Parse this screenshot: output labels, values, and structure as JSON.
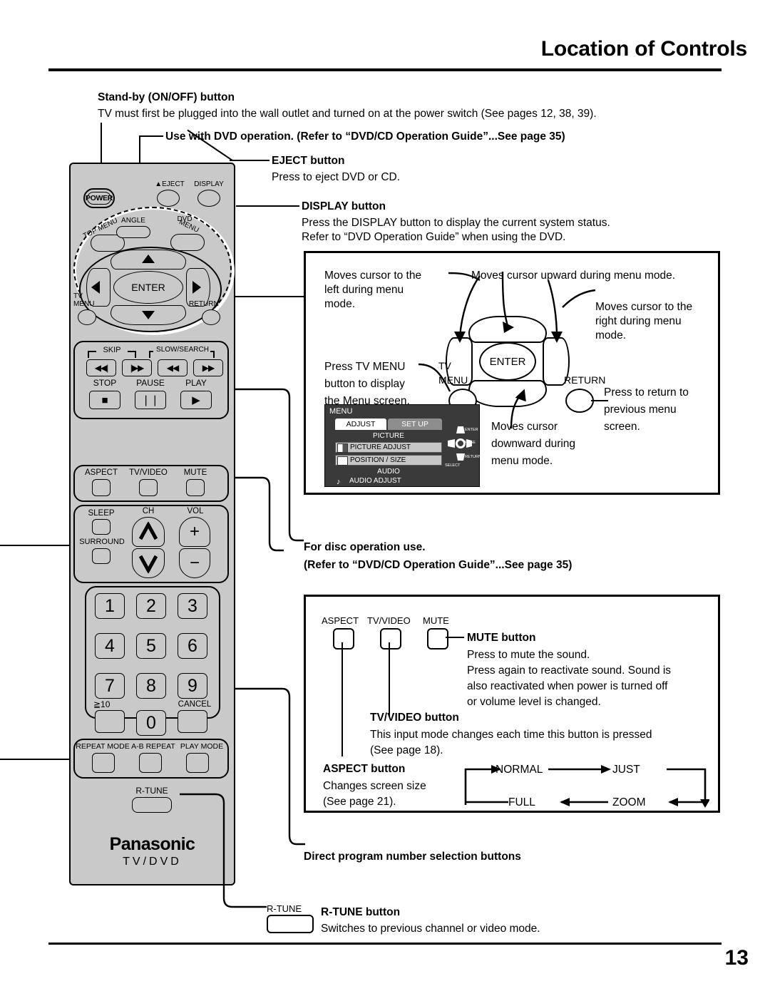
{
  "header": {
    "title": "Location of Controls"
  },
  "footer": {
    "page_number": "13"
  },
  "callouts": {
    "standby_title": "Stand-by (ON/OFF) button",
    "standby_text": "TV must first be plugged into the wall outlet and turned on at the power switch (See pages 12, 38, 39).",
    "dvd_use": "Use with DVD operation. (Refer to “DVD/CD Operation Guide”...See page 35)",
    "eject_title": "EJECT button",
    "eject_text": "Press to eject DVD or CD.",
    "display_title": "DISPLAY button",
    "display_text1": "Press the DISPLAY button to display the current system status.",
    "display_text2": "Refer to “DVD Operation Guide” when using the DVD.",
    "disc_title": "For disc operation use.",
    "disc_sub": "(Refer to “DVD/CD Operation Guide”...See page 35)",
    "direct_program": "Direct program number selection buttons",
    "rtune_title": "R-TUNE button",
    "rtune_text": "Switches to previous channel or video mode.",
    "rtune_key_label": "R-TUNE"
  },
  "cursor_panel": {
    "left": "Moves cursor to the\nleft during menu\nmode.",
    "left_l1": "Moves cursor to the",
    "left_l2": "left during menu",
    "left_l3": "mode.",
    "up": "Moves cursor upward during menu mode.",
    "right_l1": "Moves cursor to the",
    "right_l2": "right during menu",
    "right_l3": "mode.",
    "down_l1": "Moves cursor",
    "down_l2": "downward during",
    "down_l3": "menu mode.",
    "tvmenu_l1": "Press TV MENU",
    "tvmenu_l2": "button to display",
    "tvmenu_l3": "the Menu screen.",
    "return_l1": "Press to return to",
    "return_l2": "previous menu",
    "return_l3": "screen.",
    "enter_label": "ENTER",
    "tvmenu_label_1": "TV",
    "tvmenu_label_2": "MENU",
    "return_label": "RETURN"
  },
  "menu_screen": {
    "title": "MENU",
    "tab_active": "ADJUST",
    "tab_inactive": "SET UP",
    "section_picture": "PICTURE",
    "row_picture_adjust": "PICTURE  ADJUST",
    "row_position_size": "POSITION / SIZE",
    "section_audio": "AUDIO",
    "row_audio_adjust": "AUDIO  ADJUST",
    "nav_enter": "ENTER",
    "nav_page": "PAGE",
    "nav_return": "RETURN",
    "nav_select": "SELECT"
  },
  "bottom_panel": {
    "label_aspect": "ASPECT",
    "label_tvvideo": "TV/VIDEO",
    "label_mute": "MUTE",
    "mute_title": "MUTE button",
    "mute_l1": "Press to mute the sound.",
    "mute_l2": "Press again to reactivate sound. Sound is",
    "mute_l3": "also reactivated when power is turned off",
    "mute_l4": "or volume level is changed.",
    "tvvideo_title": "TV/VIDEO button",
    "tvvideo_l1": "This input mode changes each time this button is pressed",
    "tvvideo_l2": "(See page 18).",
    "aspect_title": "ASPECT button",
    "aspect_l1": "Changes screen size",
    "aspect_l2": "(See page 21).",
    "cycle": [
      "NORMAL",
      "JUST",
      "ZOOM",
      "FULL"
    ]
  },
  "remote": {
    "power": "POWER",
    "eject": "EJECT",
    "eject_arrow": "▲",
    "display": "DISPLAY",
    "top_menu": "TOP MENU",
    "angle": "ANGLE",
    "dvd": "DVD",
    "dvd_menu": "MENU",
    "tv": "TV",
    "menu": "MENU",
    "return": "RETURN",
    "enter": "ENTER",
    "skip": "SKIP",
    "slow_search": "SLOW/SEARCH",
    "skip_back": "◀◀|",
    "skip_fwd": "|▶▶",
    "search_back": "◀◀",
    "search_fwd": "▶▶",
    "stop": "STOP",
    "pause": "PAUSE",
    "play": "PLAY",
    "stop_glyph": "■",
    "pause_glyph": "❘❘",
    "play_glyph": "▶",
    "aspect": "ASPECT",
    "tvvideo": "TV/VIDEO",
    "mute": "MUTE",
    "sleep": "SLEEP",
    "surround": "SURROUND",
    "ch": "CH",
    "vol": "VOL",
    "vol_plus": "+",
    "vol_minus": "−",
    "numbers": [
      "1",
      "2",
      "3",
      "4",
      "5",
      "6",
      "7",
      "8",
      "9"
    ],
    "zero": "0",
    "ge10": "≧10",
    "cancel": "CANCEL",
    "repeat_mode": "REPEAT MODE",
    "ab_repeat": "A-B REPEAT",
    "play_mode": "PLAY MODE",
    "r_tune": "R-TUNE",
    "brand": "Panasonic",
    "brand_sub": "TV/DVD"
  }
}
